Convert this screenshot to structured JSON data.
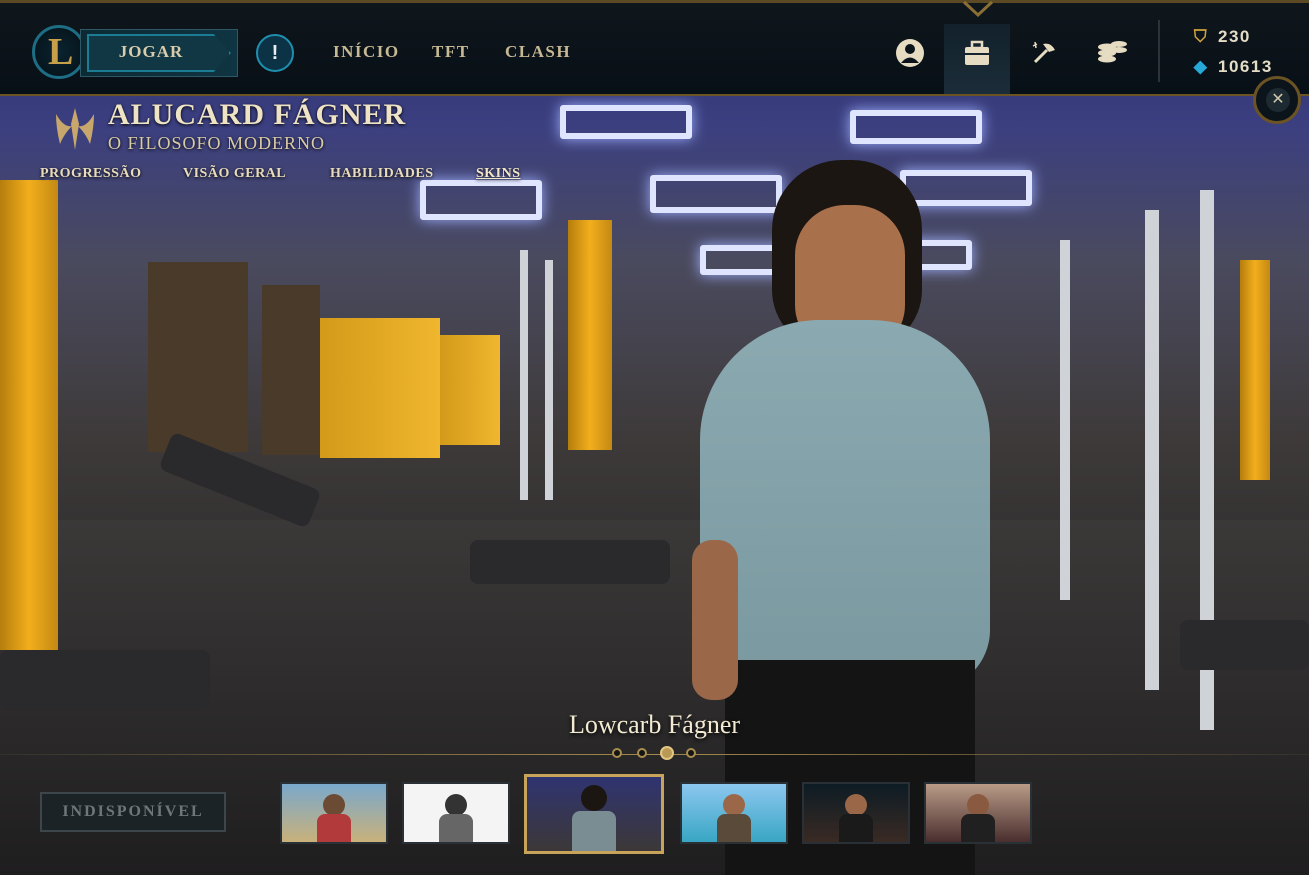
{
  "topbar": {
    "play_label": "JOGAR",
    "alert_icon": "!",
    "nav": {
      "home": "INÍCIO",
      "tft": "TFT",
      "clash": "CLASH"
    },
    "icons": [
      "profile-icon",
      "collection-icon",
      "crafting-icon",
      "store-icon"
    ],
    "currency": {
      "rp": "230",
      "blue_essence": "10613"
    }
  },
  "champion": {
    "name": "ALUCARD FÁGNER",
    "title": "O FILOSOFO MODERNO",
    "tabs": [
      "PROGRESSÃO",
      "VISÃO GERAL",
      "HABILIDADES",
      "SKINS"
    ],
    "active_tab": "SKINS"
  },
  "skin": {
    "name": "Lowcarb Fágner",
    "selected_index": 2,
    "status_button": "INDISPONÍVEL",
    "thumbnails_count": 6
  },
  "colors": {
    "gold": "#c8a35a",
    "teal": "#1b7c93",
    "text": "#e8dcbd"
  }
}
